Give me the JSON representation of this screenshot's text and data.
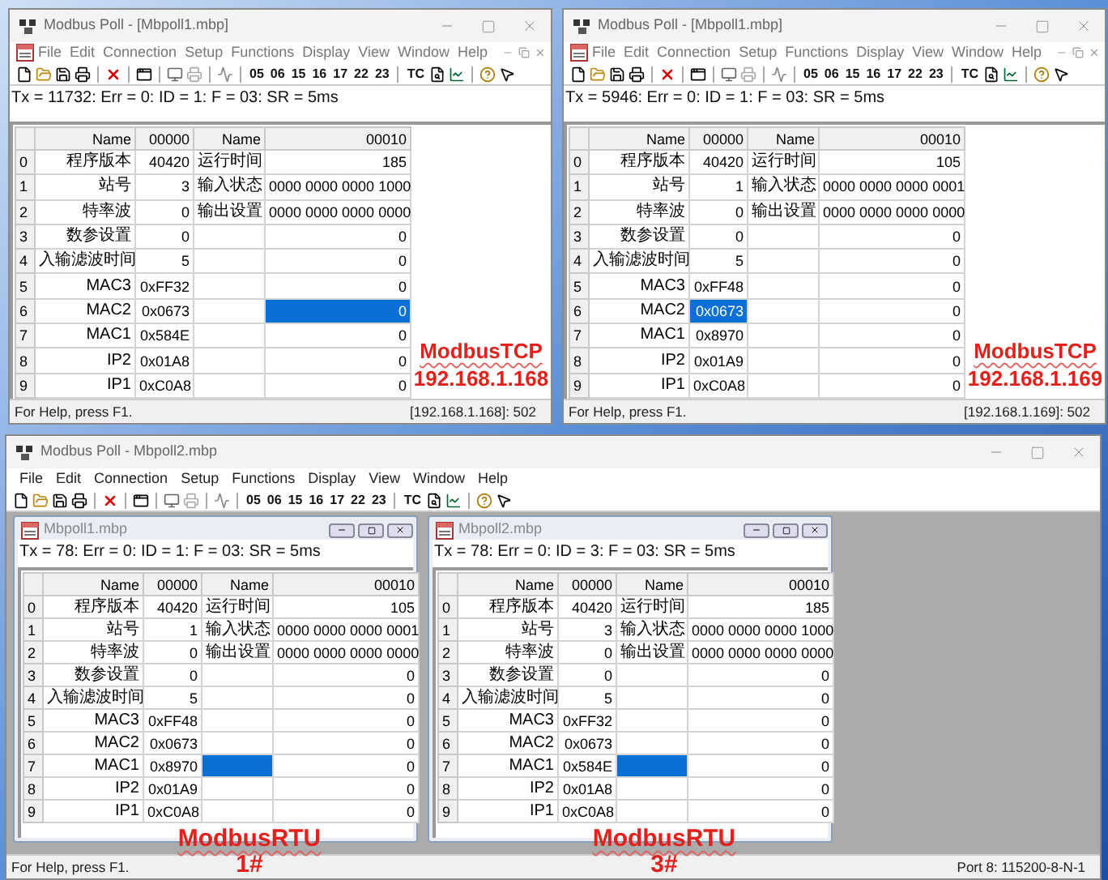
{
  "top_windows": [
    {
      "title": "Modbus Poll - [Mbpoll1.mbp]",
      "menu": [
        "File",
        "Edit",
        "Connection",
        "Setup",
        "Functions",
        "Display",
        "View",
        "Window",
        "Help"
      ],
      "toolbar_codes": [
        "05",
        "06",
        "15",
        "16",
        "17",
        "22",
        "23"
      ],
      "toolbar_tc": "TC",
      "poll_status": "Tx = 11732: Err = 0: ID = 1: F = 03: SR = 5ms",
      "grid": {
        "columns": [
          "Name",
          "00000",
          "Name",
          "00010"
        ],
        "rows": [
          {
            "index": "0",
            "cells": [
              {
                "text": "程序版本",
                "selected": false
              },
              {
                "text": "40420",
                "selected": false
              },
              {
                "text": "运行时间",
                "selected": false
              },
              {
                "text": "185",
                "selected": false
              }
            ]
          },
          {
            "index": "1",
            "cells": [
              {
                "text": "站号",
                "selected": false
              },
              {
                "text": "3",
                "selected": false
              },
              {
                "text": "输入状态",
                "selected": false
              },
              {
                "text": "0000 0000 0000 1000",
                "selected": false
              }
            ]
          },
          {
            "index": "2",
            "cells": [
              {
                "text": "特率波",
                "selected": false
              },
              {
                "text": "0",
                "selected": false
              },
              {
                "text": "输出设置",
                "selected": false
              },
              {
                "text": "0000 0000 0000 0000",
                "selected": false
              }
            ]
          },
          {
            "index": "3",
            "cells": [
              {
                "text": "数参设置",
                "selected": false
              },
              {
                "text": "0",
                "selected": false
              },
              {
                "selected": false
              },
              {
                "text": "0",
                "selected": false
              }
            ]
          },
          {
            "index": "4",
            "cells": [
              {
                "text": "入输滤波时间",
                "selected": false
              },
              {
                "text": "5",
                "selected": false
              },
              {
                "selected": false
              },
              {
                "text": "0",
                "selected": false
              }
            ]
          },
          {
            "index": "5",
            "cells": [
              {
                "text": "MAC3",
                "selected": false
              },
              {
                "text": "0xFF32",
                "selected": false
              },
              {
                "selected": false
              },
              {
                "text": "0",
                "selected": false
              }
            ]
          },
          {
            "index": "6",
            "cells": [
              {
                "text": "MAC2",
                "selected": false
              },
              {
                "text": "0x0673",
                "selected": false
              },
              {
                "selected": false
              },
              {
                "text": "0",
                "selected": true
              }
            ]
          },
          {
            "index": "7",
            "cells": [
              {
                "text": "MAC1",
                "selected": false
              },
              {
                "text": "0x584E",
                "selected": false
              },
              {
                "selected": false
              },
              {
                "text": "0",
                "selected": false
              }
            ]
          },
          {
            "index": "8",
            "cells": [
              {
                "text": "IP2",
                "selected": false
              },
              {
                "text": "0x01A8",
                "selected": false
              },
              {
                "selected": false
              },
              {
                "text": "0",
                "selected": false
              }
            ]
          },
          {
            "index": "9",
            "cells": [
              {
                "text": "IP1",
                "selected": false
              },
              {
                "text": "0xC0A8",
                "selected": false
              },
              {
                "selected": false
              },
              {
                "text": "0",
                "selected": false
              }
            ]
          }
        ]
      },
      "annotation": {
        "title": "ModbusTCP",
        "subtitle": "192.168.1.168"
      },
      "status": [
        "For Help, press F1.",
        "[192.168.1.168]: 502"
      ]
    },
    {
      "title": "Modbus Poll - [Mbpoll1.mbp]",
      "menu": [
        "File",
        "Edit",
        "Connection",
        "Setup",
        "Functions",
        "Display",
        "View",
        "Window",
        "Help"
      ],
      "toolbar_codes": [
        "05",
        "06",
        "15",
        "16",
        "17",
        "22",
        "23"
      ],
      "toolbar_tc": "TC",
      "poll_status": "Tx = 5946: Err = 0: ID = 1: F = 03: SR = 5ms",
      "grid": {
        "columns": [
          "Name",
          "00000",
          "Name",
          "00010"
        ],
        "rows": [
          {
            "index": "0",
            "cells": [
              {
                "text": "程序版本",
                "selected": false
              },
              {
                "text": "40420",
                "selected": false
              },
              {
                "text": "运行时间",
                "selected": false
              },
              {
                "text": "105",
                "selected": false
              }
            ]
          },
          {
            "index": "1",
            "cells": [
              {
                "text": "站号",
                "selected": false
              },
              {
                "text": "1",
                "selected": false
              },
              {
                "text": "输入状态",
                "selected": false
              },
              {
                "text": "0000 0000 0000 0001",
                "selected": false
              }
            ]
          },
          {
            "index": "2",
            "cells": [
              {
                "text": "特率波",
                "selected": false
              },
              {
                "text": "0",
                "selected": false
              },
              {
                "text": "输出设置",
                "selected": false
              },
              {
                "text": "0000 0000 0000 0000",
                "selected": false
              }
            ]
          },
          {
            "index": "3",
            "cells": [
              {
                "text": "数参设置",
                "selected": false
              },
              {
                "text": "0",
                "selected": false
              },
              {
                "selected": false
              },
              {
                "text": "0",
                "selected": false
              }
            ]
          },
          {
            "index": "4",
            "cells": [
              {
                "text": "入输滤波时间",
                "selected": false
              },
              {
                "text": "5",
                "selected": false
              },
              {
                "selected": false
              },
              {
                "text": "0",
                "selected": false
              }
            ]
          },
          {
            "index": "5",
            "cells": [
              {
                "text": "MAC3",
                "selected": false
              },
              {
                "text": "0xFF48",
                "selected": false
              },
              {
                "selected": false
              },
              {
                "text": "0",
                "selected": false
              }
            ]
          },
          {
            "index": "6",
            "cells": [
              {
                "text": "MAC2",
                "selected": false
              },
              {
                "text": "0x0673",
                "selected": true
              },
              {
                "selected": false
              },
              {
                "text": "0",
                "selected": false
              }
            ]
          },
          {
            "index": "7",
            "cells": [
              {
                "text": "MAC1",
                "selected": false
              },
              {
                "text": "0x8970",
                "selected": false
              },
              {
                "selected": false
              },
              {
                "text": "0",
                "selected": false
              }
            ]
          },
          {
            "index": "8",
            "cells": [
              {
                "text": "IP2",
                "selected": false
              },
              {
                "text": "0x01A9",
                "selected": false
              },
              {
                "selected": false
              },
              {
                "text": "0",
                "selected": false
              }
            ]
          },
          {
            "index": "9",
            "cells": [
              {
                "text": "IP1",
                "selected": false
              },
              {
                "text": "0xC0A8",
                "selected": false
              },
              {
                "selected": false
              },
              {
                "text": "0",
                "selected": false
              }
            ]
          }
        ]
      },
      "annotation": {
        "title": "ModbusTCP",
        "subtitle": "192.168.1.169"
      },
      "status": [
        "For Help, press F1.",
        "[192.168.1.169]: 502"
      ]
    }
  ],
  "bottom_window": {
    "title": "Modbus Poll - Mbpoll2.mbp",
    "menu": [
      "File",
      "Edit",
      "Connection",
      "Setup",
      "Functions",
      "Display",
      "View",
      "Window",
      "Help"
    ],
    "toolbar_codes": [
      "05",
      "06",
      "15",
      "16",
      "17",
      "22",
      "23"
    ],
    "toolbar_tc": "TC",
    "documents": [
      {
        "title": "Mbpoll1.mbp",
        "poll_status": "Tx = 78: Err = 0: ID = 1: F = 03: SR = 5ms",
        "grid": {
          "columns": [
            "Name",
            "00000",
            "Name",
            "00010"
          ],
          "rows": [
            {
              "index": "0",
              "cells": [
                {
                  "text": "程序版本",
                  "selected": false
                },
                {
                  "text": "40420",
                  "selected": false
                },
                {
                  "text": "运行时间",
                  "selected": false
                },
                {
                  "text": "105",
                  "selected": false
                }
              ]
            },
            {
              "index": "1",
              "cells": [
                {
                  "text": "站号",
                  "selected": false
                },
                {
                  "text": "1",
                  "selected": false
                },
                {
                  "text": "输入状态",
                  "selected": false
                },
                {
                  "text": "0000 0000 0000 0001",
                  "selected": false
                }
              ]
            },
            {
              "index": "2",
              "cells": [
                {
                  "text": "特率波",
                  "selected": false
                },
                {
                  "text": "0",
                  "selected": false
                },
                {
                  "text": "输出设置",
                  "selected": false
                },
                {
                  "text": "0000 0000 0000 0000",
                  "selected": false
                }
              ]
            },
            {
              "index": "3",
              "cells": [
                {
                  "text": "数参设置",
                  "selected": false
                },
                {
                  "text": "0",
                  "selected": false
                },
                {
                  "selected": false
                },
                {
                  "text": "0",
                  "selected": false
                }
              ]
            },
            {
              "index": "4",
              "cells": [
                {
                  "text": "入输滤波时间",
                  "selected": false
                },
                {
                  "text": "5",
                  "selected": false
                },
                {
                  "selected": false
                },
                {
                  "text": "0",
                  "selected": false
                }
              ]
            },
            {
              "index": "5",
              "cells": [
                {
                  "text": "MAC3",
                  "selected": false
                },
                {
                  "text": "0xFF48",
                  "selected": false
                },
                {
                  "selected": false
                },
                {
                  "text": "0",
                  "selected": false
                }
              ]
            },
            {
              "index": "6",
              "cells": [
                {
                  "text": "MAC2",
                  "selected": false
                },
                {
                  "text": "0x0673",
                  "selected": false
                },
                {
                  "selected": false
                },
                {
                  "text": "0",
                  "selected": false
                }
              ]
            },
            {
              "index": "7",
              "cells": [
                {
                  "text": "MAC1",
                  "selected": false
                },
                {
                  "text": "0x8970",
                  "selected": false
                },
                {
                  "selected": true
                },
                {
                  "text": "0",
                  "selected": false
                }
              ]
            },
            {
              "index": "8",
              "cells": [
                {
                  "text": "IP2",
                  "selected": false
                },
                {
                  "text": "0x01A9",
                  "selected": false
                },
                {
                  "selected": false
                },
                {
                  "text": "0",
                  "selected": false
                }
              ]
            },
            {
              "index": "9",
              "cells": [
                {
                  "text": "IP1",
                  "selected": false
                },
                {
                  "text": "0xC0A8",
                  "selected": false
                },
                {
                  "selected": false
                },
                {
                  "text": "0",
                  "selected": false
                }
              ]
            }
          ]
        },
        "annotation": {
          "title": "ModbusRTU",
          "subtitle": "1#"
        }
      },
      {
        "title": "Mbpoll2.mbp",
        "poll_status": "Tx = 78: Err = 0: ID = 3: F = 03: SR = 5ms",
        "grid": {
          "columns": [
            "Name",
            "00000",
            "Name",
            "00010"
          ],
          "rows": [
            {
              "index": "0",
              "cells": [
                {
                  "text": "程序版本",
                  "selected": false
                },
                {
                  "text": "40420",
                  "selected": false
                },
                {
                  "text": "运行时间",
                  "selected": false
                },
                {
                  "text": "185",
                  "selected": false
                }
              ]
            },
            {
              "index": "1",
              "cells": [
                {
                  "text": "站号",
                  "selected": false
                },
                {
                  "text": "3",
                  "selected": false
                },
                {
                  "text": "输入状态",
                  "selected": false
                },
                {
                  "text": "0000 0000 0000 1000",
                  "selected": false
                }
              ]
            },
            {
              "index": "2",
              "cells": [
                {
                  "text": "特率波",
                  "selected": false
                },
                {
                  "text": "0",
                  "selected": false
                },
                {
                  "text": "输出设置",
                  "selected": false
                },
                {
                  "text": "0000 0000 0000 0000",
                  "selected": false
                }
              ]
            },
            {
              "index": "3",
              "cells": [
                {
                  "text": "数参设置",
                  "selected": false
                },
                {
                  "text": "0",
                  "selected": false
                },
                {
                  "selected": false
                },
                {
                  "text": "0",
                  "selected": false
                }
              ]
            },
            {
              "index": "4",
              "cells": [
                {
                  "text": "入输滤波时间",
                  "selected": false
                },
                {
                  "text": "5",
                  "selected": false
                },
                {
                  "selected": false
                },
                {
                  "text": "0",
                  "selected": false
                }
              ]
            },
            {
              "index": "5",
              "cells": [
                {
                  "text": "MAC3",
                  "selected": false
                },
                {
                  "text": "0xFF32",
                  "selected": false
                },
                {
                  "selected": false
                },
                {
                  "text": "0",
                  "selected": false
                }
              ]
            },
            {
              "index": "6",
              "cells": [
                {
                  "text": "MAC2",
                  "selected": false
                },
                {
                  "text": "0x0673",
                  "selected": false
                },
                {
                  "selected": false
                },
                {
                  "text": "0",
                  "selected": false
                }
              ]
            },
            {
              "index": "7",
              "cells": [
                {
                  "text": "MAC1",
                  "selected": false
                },
                {
                  "text": "0x584E",
                  "selected": false
                },
                {
                  "selected": true
                },
                {
                  "text": "0",
                  "selected": false
                }
              ]
            },
            {
              "index": "8",
              "cells": [
                {
                  "text": "IP2",
                  "selected": false
                },
                {
                  "text": "0x01A8",
                  "selected": false
                },
                {
                  "selected": false
                },
                {
                  "text": "0",
                  "selected": false
                }
              ]
            },
            {
              "index": "9",
              "cells": [
                {
                  "text": "IP1",
                  "selected": false
                },
                {
                  "text": "0xC0A8",
                  "selected": false
                },
                {
                  "selected": false
                },
                {
                  "text": "0",
                  "selected": false
                }
              ]
            }
          ]
        },
        "annotation": {
          "title": "ModbusRTU",
          "subtitle": "3#"
        }
      }
    ],
    "status": [
      "For Help, press F1.",
      "Port 8: 115200-8-N-1"
    ]
  }
}
